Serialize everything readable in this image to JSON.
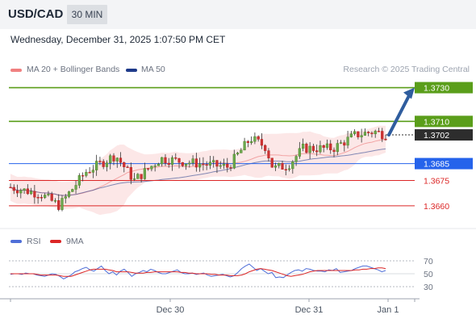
{
  "header": {
    "symbol": "USD/CAD",
    "timeframe": "30 MIN"
  },
  "timestamp": "Wednesday, December 31, 2025 1:07:50 PM CET",
  "legend": {
    "indicator1": "MA 20 + Bollinger Bands",
    "indicator1_color": "#f08080",
    "indicator2": "MA 50",
    "indicator2_color": "#1e3a8a"
  },
  "credit": "Research © 2025 Trading Central",
  "rsi_legend": {
    "rsi": "RSI",
    "rsi_color": "#4f6fd8",
    "ma": "9MA",
    "ma_color": "#dc2626"
  },
  "chart_data": {
    "type": "candlestick",
    "price_axis_range": [
      1.3647,
      1.3736
    ],
    "levels": [
      {
        "label": "1.3730",
        "value": 1.373,
        "color": "#5a9e1a",
        "kind": "resistance-target"
      },
      {
        "label": "1.3710",
        "value": 1.371,
        "color": "#5a9e1a",
        "kind": "resistance"
      },
      {
        "label": "1.3702",
        "value": 1.3702,
        "color": "#2d2d2d",
        "kind": "current-price"
      },
      {
        "label": "1.3685",
        "value": 1.3685,
        "color": "#2563eb",
        "kind": "pivot"
      },
      {
        "label": "1.3675",
        "value": 1.3675,
        "color": "#dc2626",
        "kind": "support"
      },
      {
        "label": "1.3660",
        "value": 1.366,
        "color": "#dc2626",
        "kind": "support"
      }
    ],
    "x_tick_labels": [
      "Dec 30",
      "Dec 31",
      "Jan 1"
    ],
    "rsi": {
      "range": [
        20,
        80
      ],
      "ticks": [
        "70",
        "50",
        "30"
      ],
      "series": [
        {
          "name": "RSI",
          "values": [
            49,
            50,
            50,
            49,
            51,
            50,
            50,
            48,
            47,
            46,
            48,
            50,
            49,
            46,
            42,
            45,
            48,
            53,
            55,
            58,
            60,
            56,
            54,
            58,
            62,
            55,
            50,
            53,
            48,
            54,
            57,
            52,
            46,
            50,
            52,
            55,
            53,
            57,
            55,
            52,
            50,
            50,
            52,
            54,
            56,
            52,
            50,
            50,
            51,
            49,
            50,
            51,
            48,
            46,
            47,
            48,
            49,
            47,
            45,
            47,
            52,
            58,
            62,
            65,
            60,
            55,
            58,
            54,
            50,
            52,
            44,
            45,
            44,
            48,
            52,
            55,
            56,
            54,
            58,
            57,
            55,
            54,
            54,
            53,
            56,
            55,
            58,
            52,
            53,
            54,
            55,
            58,
            60,
            62,
            62,
            60,
            58,
            56,
            53,
            55
          ]
        },
        {
          "name": "9MA",
          "values": [
            50,
            50,
            50,
            50,
            50,
            50,
            50,
            49,
            48,
            48,
            48,
            48,
            48,
            47,
            46,
            46,
            46,
            48,
            50,
            52,
            54,
            56,
            57,
            57,
            57,
            57,
            56,
            55,
            53,
            53,
            53,
            53,
            52,
            51,
            51,
            51,
            52,
            52,
            53,
            53,
            53,
            53,
            53,
            53,
            53,
            52,
            52,
            51,
            51,
            50,
            50,
            50,
            50,
            49,
            49,
            48,
            48,
            48,
            47,
            47,
            47,
            48,
            50,
            53,
            55,
            57,
            58,
            57,
            56,
            55,
            53,
            51,
            49,
            47,
            46,
            47,
            48,
            49,
            51,
            53,
            54,
            55,
            55,
            55,
            55,
            55,
            55,
            55,
            55,
            55,
            55,
            56,
            56,
            57,
            57,
            58,
            58,
            59,
            59,
            58
          ]
        }
      ]
    }
  }
}
